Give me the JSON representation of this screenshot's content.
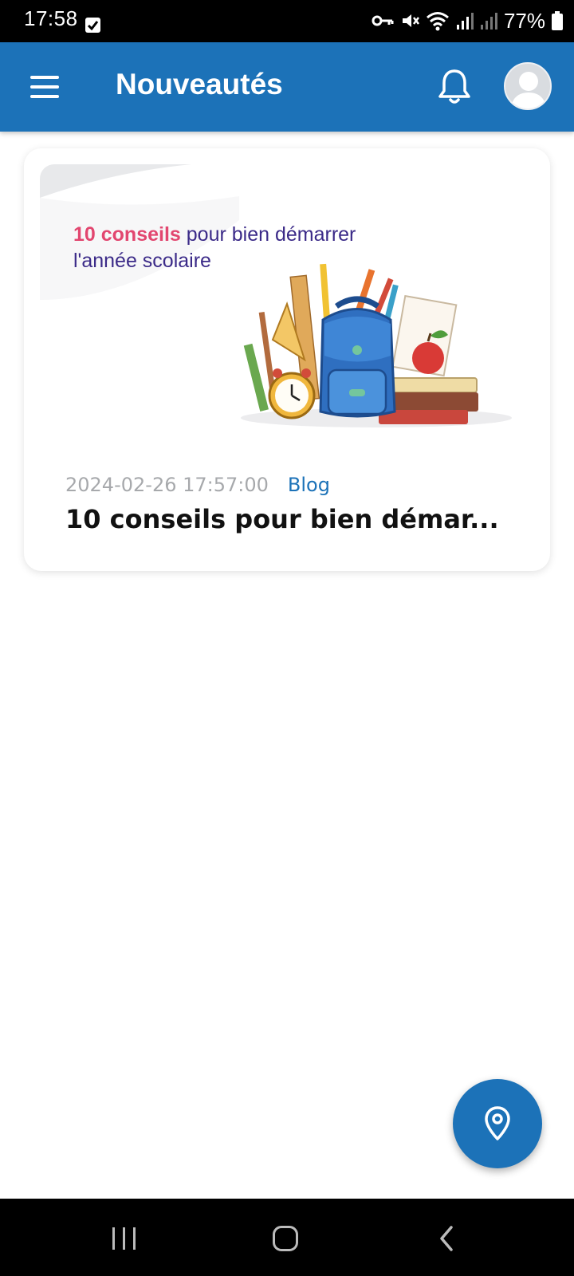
{
  "status_bar": {
    "time": "17:58",
    "battery": "77%",
    "icons": [
      "notification-check-icon",
      "vpn-key-icon",
      "mute-icon",
      "wifi-icon",
      "signal-icon",
      "signal-icon",
      "battery-icon"
    ]
  },
  "app_bar": {
    "title": "Nouveautés",
    "menu_icon": "hamburger-menu-icon",
    "bell_icon": "bell-icon",
    "avatar_icon": "user-avatar-icon"
  },
  "posts": [
    {
      "image_headline_highlight": "10 conseils",
      "image_headline_rest": " pour bien démarrer",
      "image_headline_line2": "l'année scolaire",
      "date": "2024-02-26 17:57:00",
      "category": "Blog",
      "title": "10 conseils pour bien démar..."
    }
  ],
  "fab": {
    "icon": "location-pin-icon"
  },
  "nav_bar": {
    "icons": [
      "recents-icon",
      "home-icon",
      "back-icon"
    ]
  },
  "colors": {
    "primary": "#1c72b8",
    "headline_pink": "#e2466f",
    "headline_purple": "#3b2a88",
    "date_gray": "#a7a9ac"
  }
}
